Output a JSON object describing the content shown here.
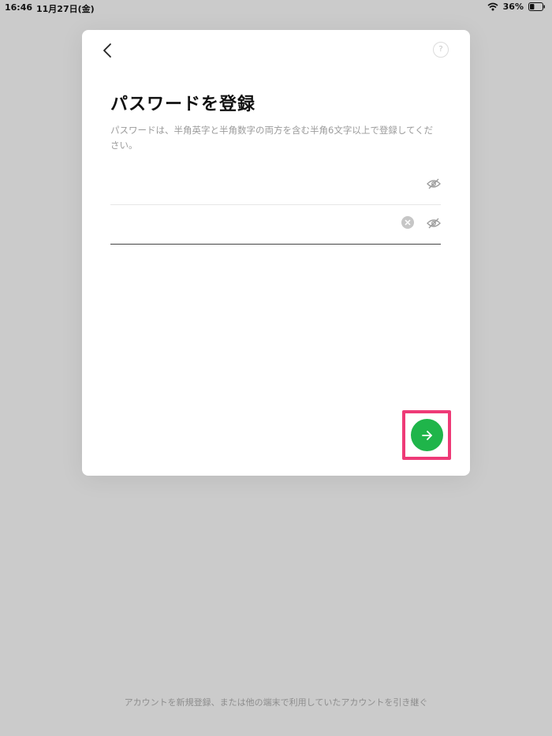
{
  "status_bar": {
    "time": "16:46",
    "date": "11月27日(金)",
    "battery_percent": "36%",
    "battery_level": 0.36
  },
  "modal": {
    "title": "パスワードを登録",
    "description": "パスワードは、半角英字と半角数字の両方を含む半角6文字以上で登録してください。",
    "help_label": "?",
    "password_field": {
      "value": "",
      "placeholder": ""
    },
    "confirm_field": {
      "value": "",
      "placeholder": ""
    }
  },
  "footer": {
    "link_text": "アカウントを新規登録、または他の端末で利用していたアカウントを引き継ぐ"
  },
  "colors": {
    "background": "#cbcbcb",
    "accent_green": "#1fb54a",
    "highlight_pink": "#ee3a77"
  },
  "icons": {
    "back": "chevron-left-icon",
    "help": "question-circle-icon",
    "visibility": "eye-off-icon",
    "clear": "clear-circle-icon",
    "next": "arrow-right-icon",
    "wifi": "wifi-icon",
    "battery": "battery-icon"
  }
}
